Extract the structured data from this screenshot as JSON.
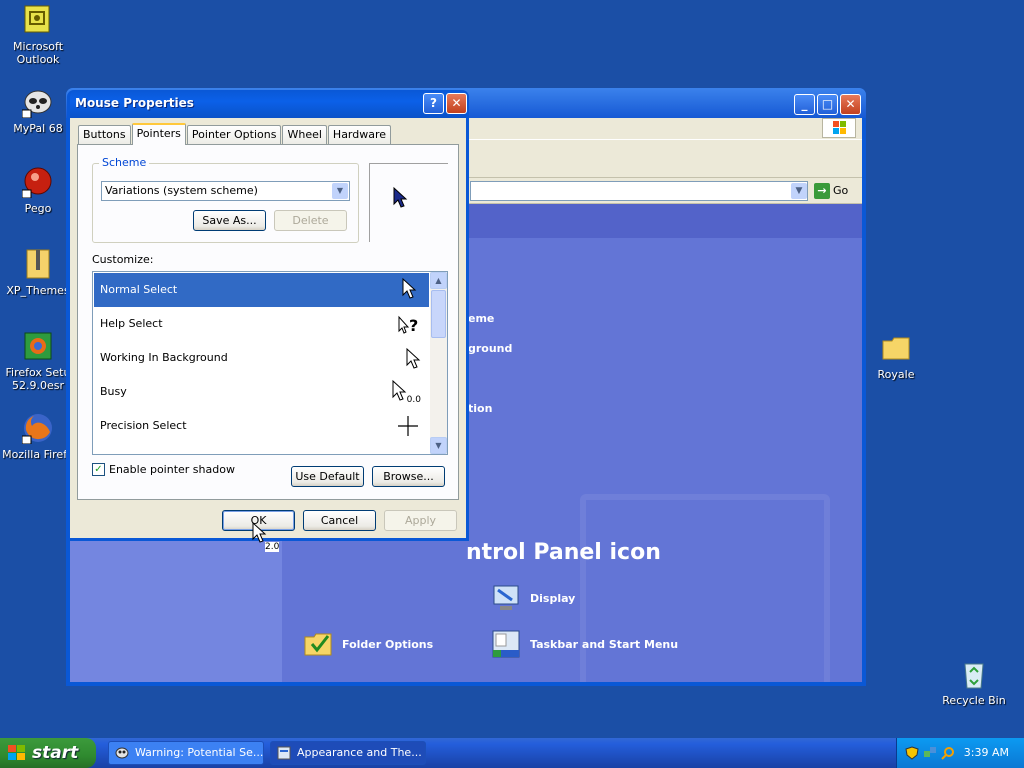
{
  "desktop": {
    "icons": [
      {
        "label": "Microsoft Outlook",
        "icon": "outlook-icon"
      },
      {
        "label": "MyPal 68",
        "icon": "mypal-icon"
      },
      {
        "label": "Pego",
        "icon": "pego-icon"
      },
      {
        "label": "XP_Themes",
        "icon": "zip-folder-icon"
      },
      {
        "label": "Firefox Setu 52.9.0esr",
        "icon": "firefox-setup-icon"
      },
      {
        "label": "Mozilla Firefo",
        "icon": "firefox-icon"
      },
      {
        "label": "Royale",
        "icon": "folder-icon"
      },
      {
        "label": "Recycle Bin",
        "icon": "recycle-bin-icon"
      }
    ]
  },
  "explorer": {
    "go_label": "Go",
    "heading": "ntrol Panel icon",
    "ghost_items": [
      "eme",
      "ground",
      "tion"
    ],
    "items": [
      {
        "label": "Display",
        "icon": "display-icon"
      },
      {
        "label": "Folder Options",
        "icon": "folder-options-icon"
      },
      {
        "label": "Taskbar and Start Menu",
        "icon": "taskbar-icon"
      }
    ]
  },
  "dialog": {
    "title": "Mouse Properties",
    "help_btn": "?",
    "close_btn": "✕",
    "tabs": [
      "Buttons",
      "Pointers",
      "Pointer Options",
      "Wheel",
      "Hardware"
    ],
    "active_tab": "Pointers",
    "scheme": {
      "legend": "Scheme",
      "value": "Variations (system scheme)",
      "save_as": "Save As...",
      "delete": "Delete"
    },
    "customize_label": "Customize:",
    "pointers": [
      {
        "label": "Normal Select",
        "icon": "arrow-cursor-icon",
        "selected": true
      },
      {
        "label": "Help Select",
        "icon": "help-cursor-icon"
      },
      {
        "label": "Working In Background",
        "icon": "arrow-cursor-icon"
      },
      {
        "label": "Busy",
        "icon": "busy-cursor-icon",
        "badge": "0.0"
      },
      {
        "label": "Precision Select",
        "icon": "crosshair-cursor-icon"
      }
    ],
    "shadow_label": "Enable pointer shadow",
    "shadow_checked": true,
    "use_default": "Use Default",
    "browse": "Browse...",
    "ok": "OK",
    "cancel": "Cancel",
    "apply": "Apply"
  },
  "cursor_badge": "2.0",
  "taskbar": {
    "start": "start",
    "tasks": [
      {
        "label": "Warning: Potential Se...",
        "icon": "mypal-icon"
      },
      {
        "label": "Appearance and The...",
        "icon": "control-panel-icon"
      }
    ],
    "clock": "3:39 AM",
    "tray_icons": [
      "security-shield-icon",
      "network-icon",
      "search-icon"
    ]
  },
  "colors": {
    "desktop": "#1b4fa6",
    "selection": "#316ac5",
    "dialog_face": "#ece9d8"
  }
}
